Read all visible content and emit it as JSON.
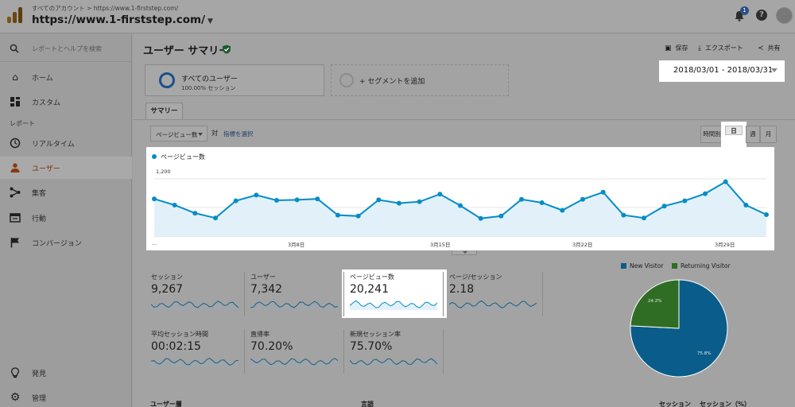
{
  "header": {
    "breadcrumb": "すべてのアカウント > https://www.1-firststep.com/",
    "account": "https://www.1-firststep.com/",
    "notification_count": "1",
    "help_glyph": "?"
  },
  "sidebar": {
    "search_placeholder": "レポートとヘルプを検索",
    "top_items": [
      {
        "label": "ホーム",
        "icon": "home-icon"
      },
      {
        "label": "カスタム",
        "icon": "dashboard-icon"
      }
    ],
    "section_label": "レポート",
    "report_items": [
      {
        "label": "リアルタイム",
        "icon": "clock-icon"
      },
      {
        "label": "ユーザー",
        "icon": "person-icon",
        "active": true
      },
      {
        "label": "集客",
        "icon": "acquisition-icon"
      },
      {
        "label": "行動",
        "icon": "behavior-icon"
      },
      {
        "label": "コンバージョン",
        "icon": "flag-icon"
      }
    ],
    "bottom_items": [
      {
        "label": "発見",
        "icon": "lightbulb-icon"
      },
      {
        "label": "管理",
        "icon": "gear-icon"
      }
    ]
  },
  "page": {
    "title": "ユーザー サマリー",
    "tools": {
      "save": "保存",
      "export": "エクスポート",
      "share": "共有"
    },
    "segment": {
      "name": "すべてのユーザー",
      "sub": "100.00% セッション",
      "add": "+ セグメントを追加"
    },
    "date_range": "2018/03/01 - 2018/03/31",
    "tab": "サマリー",
    "metric_select": "ページビュー数",
    "vs": "対",
    "pick_metric": "指標を選択",
    "granularity": [
      "時間別",
      "日",
      "週",
      "月"
    ],
    "granularity_selected": "日"
  },
  "chart_data": {
    "type": "area",
    "legend": "ページビュー数",
    "series_color": "#058dc7",
    "y_ticks": [
      "1,200",
      "600"
    ],
    "ylim": [
      0,
      1500
    ],
    "x_ticks": [
      "...",
      "3月8日",
      "3月15日",
      "3月22日",
      "3月29日"
    ],
    "x": [
      1,
      2,
      3,
      4,
      5,
      6,
      7,
      8,
      9,
      10,
      11,
      12,
      13,
      14,
      15,
      16,
      17,
      18,
      19,
      20,
      21,
      22,
      23,
      24,
      25,
      26,
      27,
      28,
      29,
      30,
      31
    ],
    "values": [
      780,
      650,
      480,
      380,
      740,
      860,
      750,
      760,
      780,
      440,
      420,
      760,
      690,
      720,
      880,
      640,
      370,
      420,
      770,
      700,
      540,
      770,
      920,
      440,
      380,
      630,
      740,
      890,
      1140,
      650,
      450
    ]
  },
  "metrics": [
    {
      "label": "セッション",
      "value": "9,267"
    },
    {
      "label": "ユーザー",
      "value": "7,342"
    },
    {
      "label": "ページビュー数",
      "value": "20,241"
    },
    {
      "label": "ページ/セッション",
      "value": "2.18"
    },
    {
      "label": "平均セッション時間",
      "value": "00:02:15"
    },
    {
      "label": "直帰率",
      "value": "70.20%"
    },
    {
      "label": "新規セッション率",
      "value": "75.70%"
    }
  ],
  "pie": {
    "legend": [
      {
        "name": "New Visitor",
        "color": "#0a5d8a"
      },
      {
        "name": "Returning Visitor",
        "color": "#2f6d24"
      }
    ],
    "slices": [
      {
        "name": "New Visitor",
        "value": 75.8,
        "label": "75.8%",
        "color": "#0a5d8a"
      },
      {
        "name": "Returning Visitor",
        "value": 24.2,
        "label": "24.2%",
        "color": "#2f6d24"
      }
    ]
  },
  "table_headers": {
    "user_type": "ユーザー層",
    "language": "言語",
    "sessions": "セッション",
    "sessions_pct": "セッション（%）"
  }
}
